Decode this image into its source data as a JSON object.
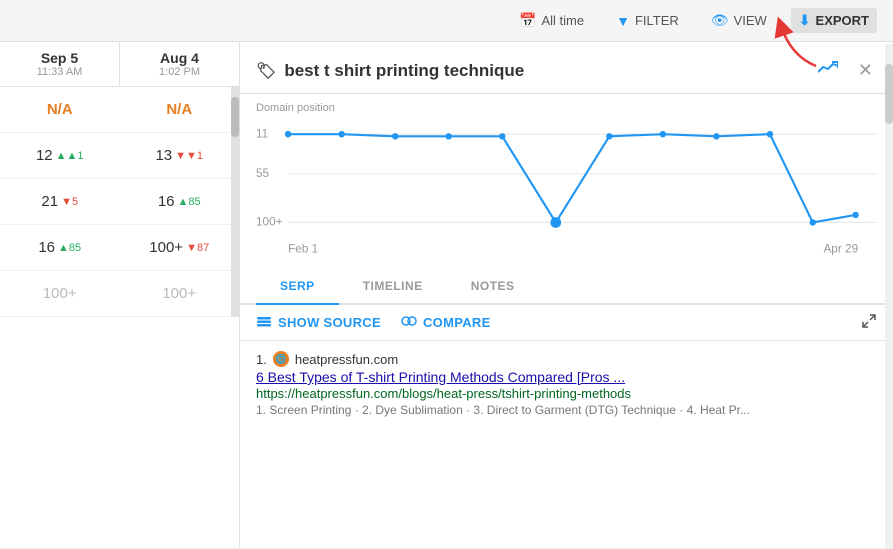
{
  "topbar": {
    "alltime_label": "All time",
    "filter_label": "FILTER",
    "view_label": "VIEW",
    "export_label": "EXPORT"
  },
  "left_panel": {
    "col1": {
      "date": "Sep 5",
      "time": "11:33 AM"
    },
    "col2": {
      "date": "Aug 4",
      "time": "1:02 PM"
    },
    "rows": [
      {
        "v1": "N/A",
        "v1_na": true,
        "v2": "N/A",
        "v2_na": true,
        "d1": "",
        "d2": ""
      },
      {
        "v1": "12",
        "v2": "13",
        "d1": "1",
        "d1_dir": "up",
        "d2": "1",
        "d2_dir": "down"
      },
      {
        "v1": "21",
        "v2": "16",
        "d1": "5",
        "d1_dir": "down",
        "d2": "85",
        "d2_dir": "up"
      },
      {
        "v1": "16",
        "v1_sup": "85",
        "v1_sup_dir": "up",
        "v2": "100+",
        "d2": "87",
        "d2_dir": "down"
      },
      {
        "v1": "100+",
        "v2": "100+",
        "d1": "",
        "d2": ""
      }
    ]
  },
  "keyword": {
    "title": "best t shirt printing technique",
    "chart": {
      "y_label": "Domain position",
      "x_start": "Feb 1",
      "x_end": "Apr 29",
      "y_ticks": [
        "11",
        "55",
        "100+"
      ]
    }
  },
  "tabs": [
    {
      "label": "SERP",
      "active": true
    },
    {
      "label": "TIMELINE",
      "active": false
    },
    {
      "label": "NOTES",
      "active": false
    }
  ],
  "serp_toolbar": {
    "show_source": "SHOW SOURCE",
    "compare": "COMPARE"
  },
  "result": {
    "num": "1.",
    "domain": "heatpressfun.com",
    "title": "6 Best Types of T-shirt Printing Methods Compared [Pros ...",
    "url": "https://heatpressfun.com/blogs/heat-press/tshirt-printing-methods",
    "snippet": "1. Screen Printing · 2. Dye Sublimation · 3. Direct to Garment (DTG) Technique · 4. Heat Pr..."
  }
}
